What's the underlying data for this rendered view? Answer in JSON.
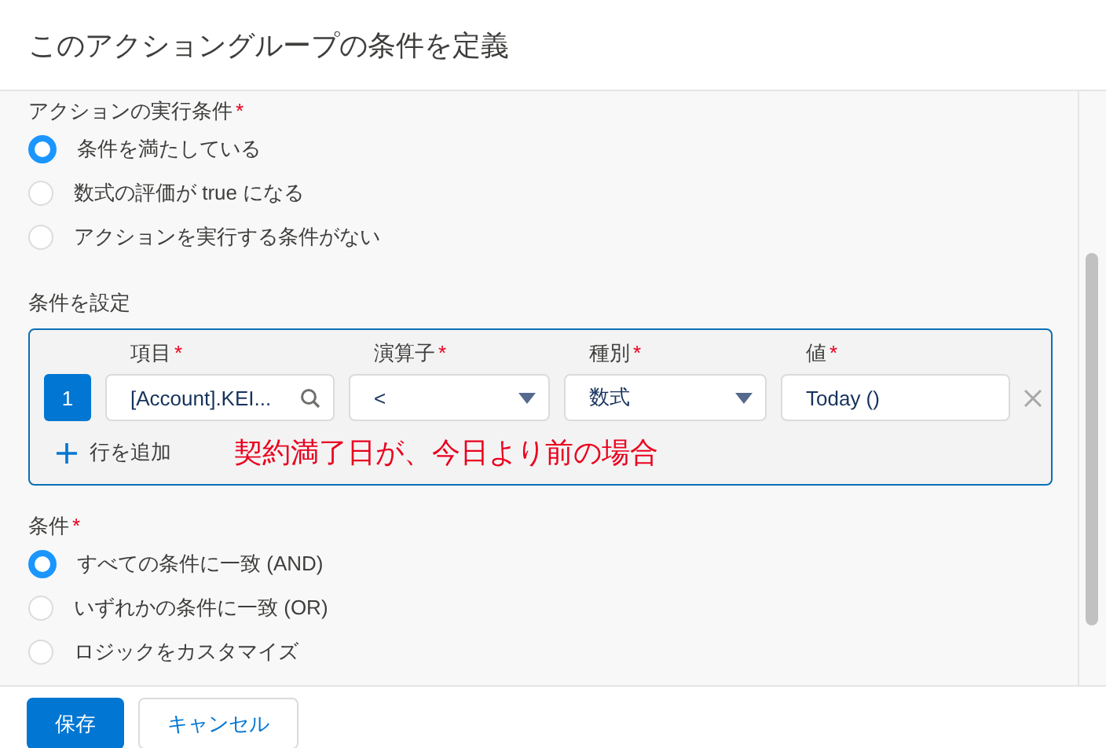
{
  "title": "このアクショングループの条件を定義",
  "action_condition": {
    "label": "アクションの実行条件",
    "required_mark": "*",
    "options": [
      {
        "label": "条件を満たしている",
        "selected": true
      },
      {
        "label": "数式の評価が true になる",
        "selected": false
      },
      {
        "label": "アクションを実行する条件がない",
        "selected": false
      }
    ]
  },
  "condition_set": {
    "label": "条件を設定",
    "rows": [
      {
        "number": "1",
        "fields": [
          {
            "label": "項目",
            "required_mark": "*",
            "kind": "lookup",
            "value": "[Account].KEI..."
          },
          {
            "label": "演算子",
            "required_mark": "*",
            "kind": "select",
            "value": "<"
          },
          {
            "label": "種別",
            "required_mark": "*",
            "kind": "select",
            "value": "数式"
          },
          {
            "label": "値",
            "required_mark": "*",
            "kind": "text",
            "value": "Today ()"
          }
        ]
      }
    ],
    "add_row": "行を追加",
    "annotation": "契約満了日が、今日より前の場合"
  },
  "logic": {
    "label": "条件",
    "required_mark": "*",
    "options": [
      {
        "label": "すべての条件に一致 (AND)",
        "selected": true
      },
      {
        "label": "いずれかの条件に一致 (OR)",
        "selected": false
      },
      {
        "label": "ロジックをカスタマイズ",
        "selected": false
      }
    ]
  },
  "buttons": [
    {
      "label": "保存",
      "kind": "primary"
    },
    {
      "label": "キャンセル",
      "kind": "neutral"
    }
  ]
}
